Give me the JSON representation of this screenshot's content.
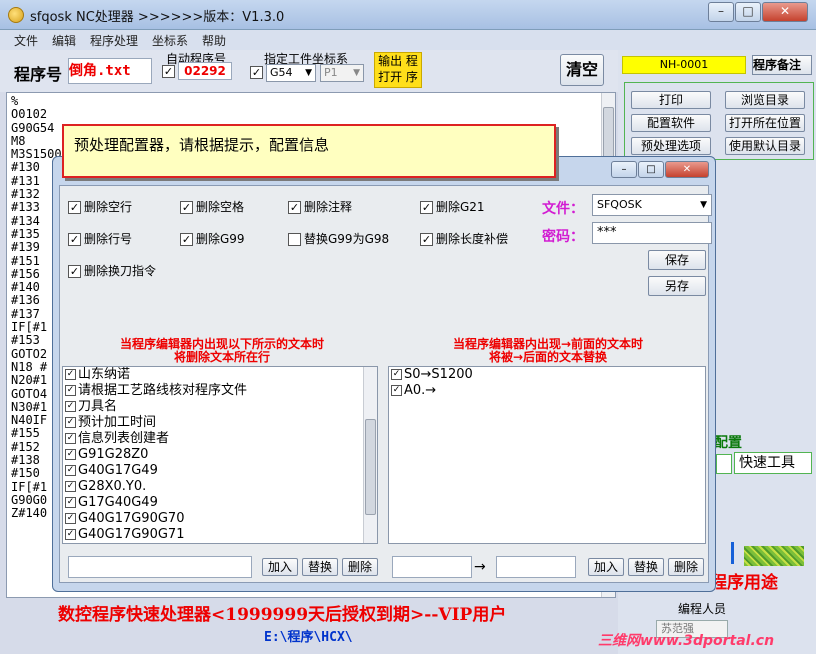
{
  "window": {
    "title": "sfqosk NC处理器  >>>>>>版本：V1.3.0",
    "min": "–",
    "max": "□",
    "close": "✕"
  },
  "menu": [
    "文件",
    "编辑",
    "程序处理",
    "坐标系",
    "帮助"
  ],
  "toolbar": {
    "program_label": "程序号",
    "filename": "倒角.txt",
    "auto_label": "自动程序号",
    "auto_check": "✓",
    "auto_number": "02292",
    "coord_label": "指定工件坐标系",
    "coord_check": "✓",
    "coord_value": "G54",
    "coord_sub": "P1",
    "output_button": "输出 程\n打开 序",
    "clear_button": "清空"
  },
  "editor": {
    "lines": [
      "%",
      "O0102",
      "G90G54",
      "M8",
      "M3S1500",
      "#130",
      "#131",
      "#132",
      "#133",
      "#134",
      "#135",
      "#139",
      "#151",
      "#156",
      "#140",
      "#136",
      "#137",
      "IF[#1",
      "#153",
      "GOTO2",
      "N18 #",
      "N20#1",
      "GOTO4",
      "N30#1",
      "N40IF",
      "#155",
      "#152",
      "#138",
      "#150",
      "IF[#1",
      "G90G0",
      "Z#140"
    ]
  },
  "right_panel": {
    "nh_code": "NH-0001",
    "note_button": "程序备注",
    "buttons": [
      "打印",
      "浏览目录",
      "配置软件",
      "打开所在位置",
      "预处理选项",
      "使用默认目录"
    ],
    "config_label": "配置",
    "quick_tools": "快速工具",
    "usage_label": "程序用途",
    "programmer_label": "编程人员",
    "programmer_value": "苏范强",
    "watermark": "三维网www.3dportal.cn"
  },
  "bottom": {
    "title": "数控程序快速处理器<1999999天后授权到期>--VIP用户",
    "path": "E:\\程序\\HCX\\"
  },
  "tooltip": {
    "text": "预处理配置器，请根据提示，配置信息"
  },
  "dialog": {
    "min": "–",
    "max": "□",
    "close": "✕",
    "options": [
      {
        "label": "删除空行",
        "checked": "✓"
      },
      {
        "label": "删除空格",
        "checked": "✓"
      },
      {
        "label": "删除注释",
        "checked": "✓"
      },
      {
        "label": "删除G21",
        "checked": "✓"
      },
      {
        "label": "删除行号",
        "checked": "✓"
      },
      {
        "label": "删除G99",
        "checked": "✓"
      },
      {
        "label": "替换G99为G98",
        "checked": ""
      },
      {
        "label": "删除长度补偿",
        "checked": "✓"
      },
      {
        "label": "删除换刀指令",
        "checked": "✓"
      }
    ],
    "file_label": "文件：",
    "file_value": "SFQOSK",
    "password_label": "密码：",
    "password_value": "***",
    "save_button": "保存",
    "saveas_button": "另存",
    "left_header": "当程序编辑器内出现以下所示的文本时\n将删除文本所在行",
    "right_header": "当程序编辑器内出现→前面的文本时\n将被→后面的文本替换",
    "delete_list": [
      "山东纳诺",
      "请根据工艺路线核对程序文件",
      "刀具名",
      "预计加工时间",
      "信息列表创建者",
      "G91G28Z0",
      "G40G17G49",
      "G28X0.Y0.",
      "G17G40G49",
      "G40G17G90G70",
      "G40G17G90G71"
    ],
    "replace_list": [
      "S0→S1200",
      "A0.→"
    ],
    "add_button": "加入",
    "replace_button": "替换",
    "delete_button": "删除",
    "arrow": "→"
  }
}
